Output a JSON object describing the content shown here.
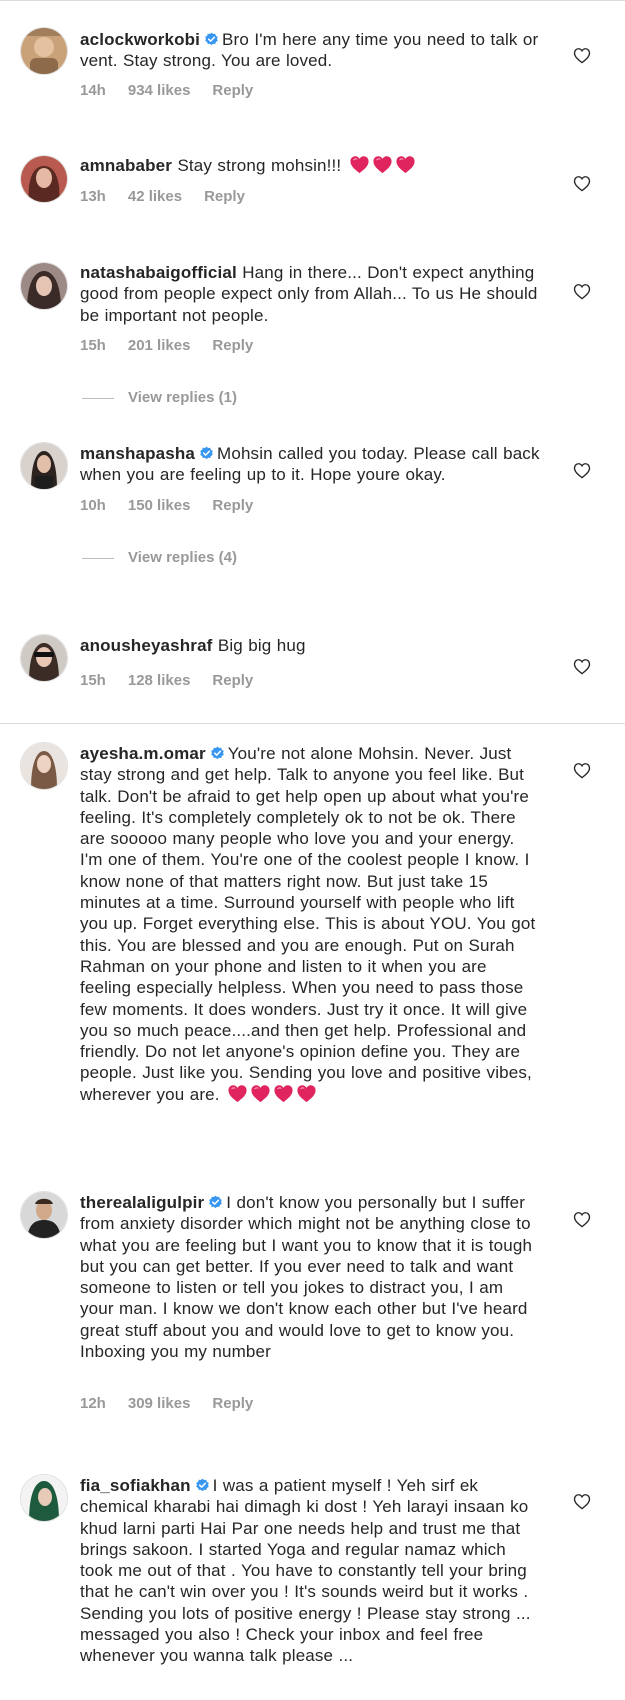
{
  "comments": [
    {
      "username": "aclockworkobi",
      "verified": true,
      "text": "Bro I'm here any time you need to talk or vent. Stay strong. You are loved.",
      "time": "14h",
      "likes": "934 likes",
      "reply": "Reply"
    },
    {
      "username": "amnababer",
      "verified": false,
      "text": "Stay strong mohsin!!!",
      "hearts": 3,
      "time": "13h",
      "likes": "42 likes",
      "reply": "Reply"
    },
    {
      "username": "natashabaigofficial",
      "verified": false,
      "text": "Hang in there... Don't expect anything good from people expect only from Allah... To us He should be important not people.",
      "time": "15h",
      "likes": "201 likes",
      "reply": "Reply",
      "view_replies": "View replies (1)"
    },
    {
      "username": "manshapasha",
      "verified": true,
      "text": "Mohsin called you today. Please call back when you are feeling up to it. Hope youre okay.",
      "time": "10h",
      "likes": "150 likes",
      "reply": "Reply",
      "view_replies": "View replies (4)"
    },
    {
      "username": "anousheyashraf",
      "verified": false,
      "text": "Big big hug",
      "time": "15h",
      "likes": "128 likes",
      "reply": "Reply"
    },
    {
      "username": "ayesha.m.omar",
      "verified": true,
      "text": "You're not alone Mohsin. Never. Just stay strong and get help. Talk to anyone you feel like. But talk. Don't be afraid to get help open up about what you're feeling. It's completely completely ok to not be ok. There are sooooo many people who love you and your energy. I'm one of them. You're one of the coolest people I know. I know none of that matters right now. But just take 15 minutes at a time. Surround yourself with people who lift you up. Forget everything else. This is about YOU. You got this. You are blessed and you are enough. Put on Surah Rahman on your phone and listen to it when you are feeling especially helpless. When you need to pass those few moments. It does wonders. Just try it once. It will give you so much peace....and then get help. Professional and friendly. Do not let anyone's opinion define you. They are people. Just like you. Sending you love and positive vibes, wherever you are.",
      "hearts": 4
    },
    {
      "username": "therealaligulpir",
      "verified": true,
      "text": "I don't know you personally but I suffer from anxiety disorder which might not be anything close to what you are feeling but I want you to know that it is tough but you can get better. If you ever need to talk and want someone to listen or tell you jokes to distract you, I am your man. I know we don't know each other but I've heard great stuff about you and would love to get to know you. Inboxing you my number",
      "time": "12h",
      "likes": "309 likes",
      "reply": "Reply"
    },
    {
      "username": "fia_sofiakhan",
      "verified": true,
      "text": "I was a patient myself ! Yeh sirf ek chemical kharabi hai dimagh ki dost ! Yeh larayi insaan ko khud larni parti Hai Par one needs help and trust me that brings sakoon. I started Yoga and regular namaz which took me out of that . You have to constantly tell your bring that he can't win over you ! It's sounds weird but it works . Sending you lots of positive energy ! Please stay strong ... messaged you also ! Check your inbox and feel free whenever you wanna talk please ..."
    }
  ],
  "icons": {
    "verified": "verified-badge-icon",
    "like": "heart-outline-icon",
    "emoji": "red-heart-emoji"
  },
  "colors": {
    "text": "#262626",
    "meta": "#999999",
    "verified": "#3897f0",
    "heart": "#e0245e"
  }
}
